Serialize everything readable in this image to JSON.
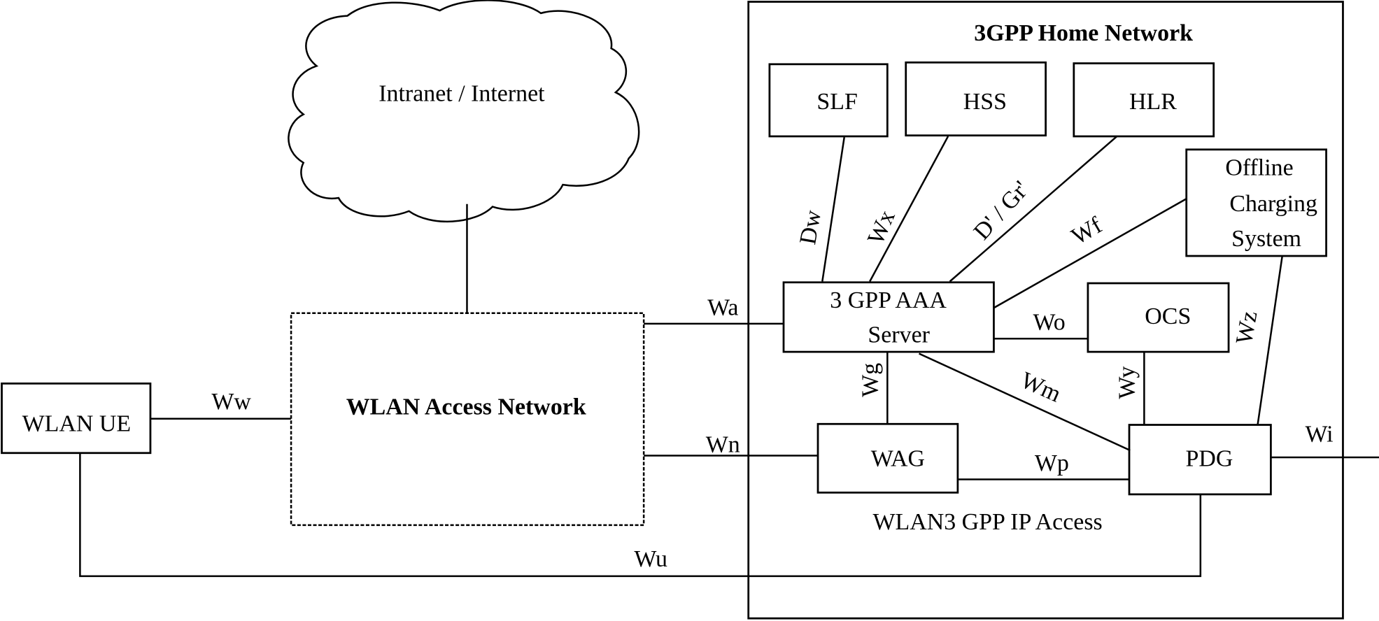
{
  "diagram": {
    "home_network_title": "3GPP Home Network",
    "cloud_label": "Intranet / Internet",
    "access_network_label": "WLAN Access Network",
    "ip_access_label": "WLAN3  GPP IP Access",
    "nodes": {
      "slf": "SLF",
      "hss": "HSS",
      "hlr": "HLR",
      "ocs_offline_line1": "Offline",
      "ocs_offline_line2": "Charging",
      "ocs_offline_line3": "System",
      "aaa_line1": "3  GPP AAA",
      "aaa_line2": "Server",
      "ocs": "OCS",
      "wag": "WAG",
      "pdg": "PDG",
      "ue": "WLAN UE"
    },
    "interfaces": {
      "dw": "Dw",
      "wx": "Wx",
      "d_gr": "D' / Gr'",
      "wf": "Wf",
      "wa": "Wa",
      "wo": "Wo",
      "wg": "Wg",
      "wm": "Wm",
      "wy": "Wy",
      "wz": "Wz",
      "ww": "Ww",
      "wn": "Wn",
      "wp": "Wp",
      "wi": "Wi",
      "wu": "Wu"
    }
  }
}
